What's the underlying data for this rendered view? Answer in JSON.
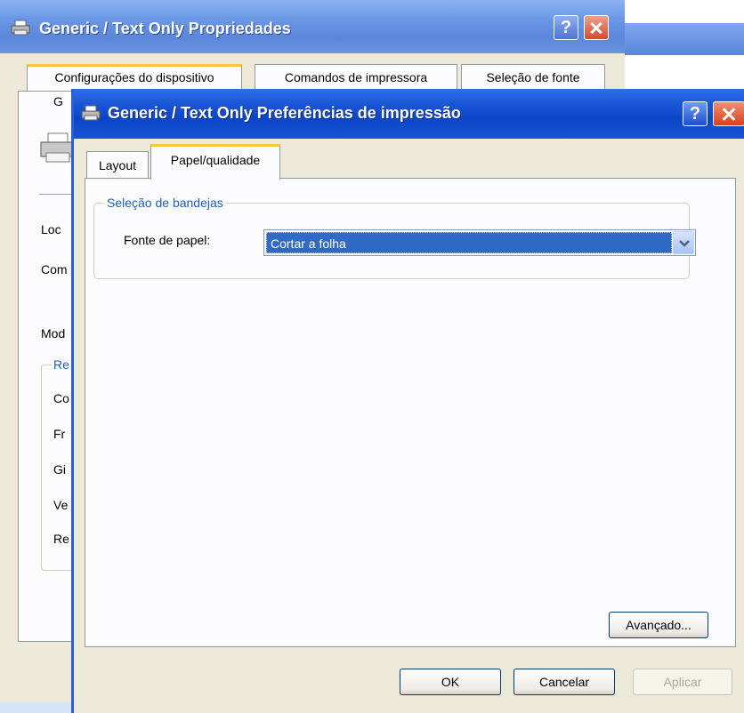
{
  "background_window": {
    "title": "Generic / Text Only Propriedades",
    "tabs": [
      "Configurações do dispositivo",
      "Comandos de impressora",
      "Seleção de fonte"
    ],
    "partial_tab_text": "G",
    "partial_labels": [
      "Loc",
      "Com",
      "Mod"
    ],
    "group_title_partial": "Re",
    "group_items_partial": [
      "Co",
      "Fr",
      "Gi",
      "Ve",
      "Re"
    ]
  },
  "dialog": {
    "title": "Generic / Text Only Preferências de impressão",
    "tabs": [
      "Layout",
      "Papel/qualidade"
    ],
    "active_tab": "Papel/qualidade",
    "tray_group": {
      "title": "Seleção de bandejas",
      "paper_source_label": "Fonte de papel:",
      "paper_source_value": "Cortar a folha"
    },
    "buttons": {
      "advanced": "Avançado...",
      "ok": "OK",
      "cancel": "Cancelar",
      "apply": "Aplicar"
    }
  },
  "icons": [
    "printer-icon",
    "help-icon",
    "close-icon",
    "chevron-down-icon"
  ],
  "colors": {
    "titlebar_active": "#0a46c8",
    "titlebar_inactive": "#6a97e6",
    "selection": "#316ac5",
    "tab_highlight": "#ffc73c",
    "group_title": "#1c5fb4"
  }
}
